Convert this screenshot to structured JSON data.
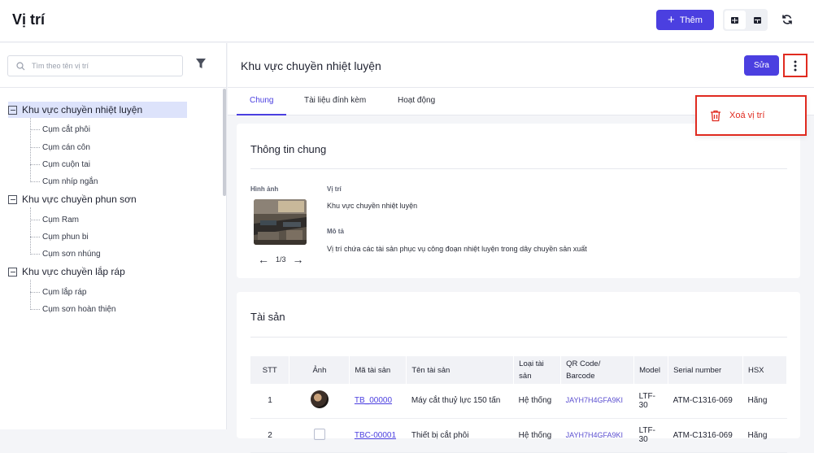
{
  "header": {
    "title": "Vị trí",
    "add_label": "Thêm"
  },
  "sidebar": {
    "search_placeholder": "Tìm theo tên vị trí",
    "tree": [
      {
        "label": "Khu vực chuyền nhiệt luyện",
        "selected": true,
        "children": [
          "Cụm cắt phôi",
          "Cụm cán côn",
          "Cụm cuộn tai",
          "Cụm nhíp ngắn"
        ]
      },
      {
        "label": "Khu vực chuyền phun sơn",
        "selected": false,
        "children": [
          "Cụm Ram",
          "Cụm phun bi",
          "Cụm sơn nhúng"
        ]
      },
      {
        "label": "Khu vực chuyền lắp ráp",
        "selected": false,
        "children": [
          "Cụm lắp ráp",
          "Cụm sơn hoàn thiện"
        ]
      }
    ]
  },
  "detail": {
    "title": "Khu vực chuyền nhiệt luyện",
    "edit_label": "Sửa",
    "menu": {
      "delete_label": "Xoá vị trí"
    },
    "tabs": [
      "Chung",
      "Tài liệu đính kèm",
      "Hoạt động"
    ],
    "general": {
      "heading": "Thông tin chung",
      "image_label": "Hình ảnh",
      "pager": "1/3",
      "location_label": "Vị trí",
      "location_value": "Khu vực chuyền nhiệt luyện",
      "description_label": "Mô tả",
      "description_value": "Vị trí chứa các tài sản phục vụ công đoạn nhiệt luyện trong dây chuyền sản xuất"
    },
    "assets": {
      "heading": "Tài sản",
      "columns": [
        "STT",
        "Ảnh",
        "Mã tài sản",
        "Tên tài sản",
        "Loại tài sản",
        "QR Code/ Barcode",
        "Model",
        "Serial number",
        "HSX"
      ],
      "rows": [
        {
          "stt": "1",
          "code": "TB_00000",
          "name": "Máy cắt thuỷ lực 150 tấn",
          "type": "Hệ thống",
          "qr": "JAYH7H4GFA9KI",
          "model": "LTF-30",
          "serial": "ATM-C1316-069",
          "maker": "Hãng"
        },
        {
          "stt": "2",
          "code": "TBC-00001",
          "name": "Thiết bị cắt phôi",
          "type": "Hệ thống",
          "qr": "JAYH7H4GFA9KI",
          "model": "LTF-30",
          "serial": "ATM-C1316-069",
          "maker": "Hãng"
        }
      ]
    }
  },
  "colors": {
    "primary": "#4b3fe0",
    "danger": "#e02b20",
    "selected_bg": "#dde3fb"
  }
}
